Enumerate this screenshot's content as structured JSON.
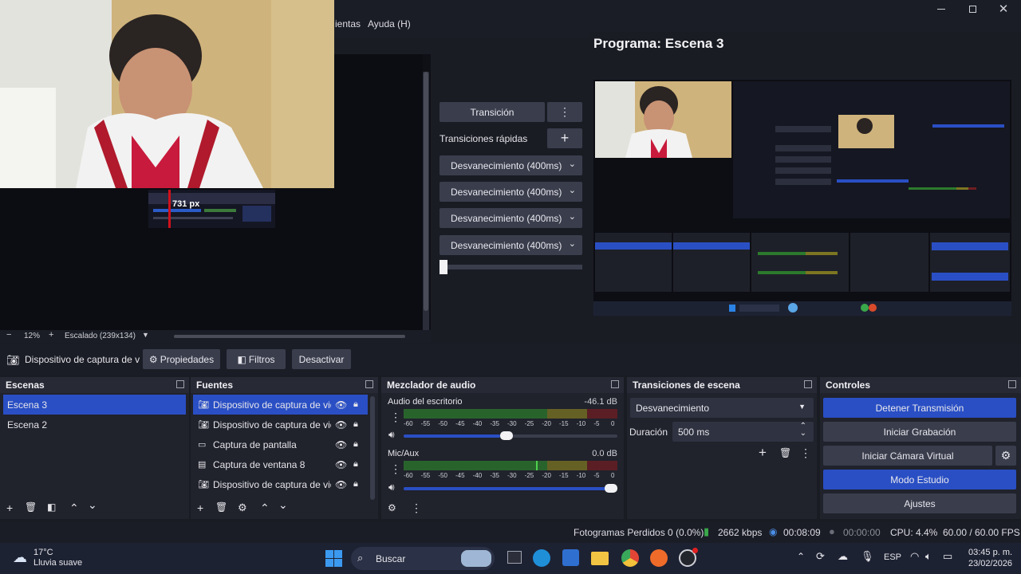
{
  "menu": {
    "item_tools_partial": "ientas",
    "item_help": "Ayuda (H)"
  },
  "program": {
    "title": "Programa: Escena 3"
  },
  "preview": {
    "zoom": "12%",
    "scale_label": "Escalado (239x134)",
    "overlay_px": "731 px"
  },
  "transition_center": {
    "transition_button": "Transición",
    "quick_transitions_label": "Transiciones rápidas",
    "quick_items": [
      "Desvanecimiento (400ms)",
      "Desvanecimiento (400ms)",
      "Desvanecimiento (400ms)",
      "Desvanecimiento (400ms)"
    ]
  },
  "source_toolbar": {
    "source_name": "Dispositivo de captura de v",
    "properties": "Propiedades",
    "filters": "Filtros",
    "deactivate": "Desactivar"
  },
  "scenes": {
    "title": "Escenas",
    "items": [
      {
        "label": "Escena 3",
        "selected": true
      },
      {
        "label": "Escena 2",
        "selected": false
      }
    ]
  },
  "sources": {
    "title": "Fuentes",
    "items": [
      {
        "label": "Dispositivo de captura de vide",
        "icon": "camera-icon",
        "selected": true
      },
      {
        "label": "Dispositivo de captura de vide",
        "icon": "camera-icon",
        "selected": false
      },
      {
        "label": "Captura de pantalla",
        "icon": "monitor-icon",
        "selected": false
      },
      {
        "label": "Captura de ventana 8",
        "icon": "window-icon",
        "selected": false
      },
      {
        "label": "Dispositivo de captura de vide",
        "icon": "camera-icon",
        "selected": false
      }
    ]
  },
  "mixer": {
    "title": "Mezclador de audio",
    "channels": [
      {
        "name": "Audio del escritorio",
        "db": "-46.1 dB",
        "level": 0.0,
        "volume": 0.45
      },
      {
        "name": "Mic/Aux",
        "db": "0.0 dB",
        "level": 0.62,
        "volume": 1.0
      }
    ],
    "ticks": [
      "-60",
      "-55",
      "-50",
      "-45",
      "-40",
      "-35",
      "-30",
      "-25",
      "-20",
      "-15",
      "-10",
      "-5",
      "0"
    ]
  },
  "scene_transitions": {
    "title": "Transiciones de escena",
    "selected": "Desvanecimiento",
    "duration_label": "Duración",
    "duration_value": "500 ms"
  },
  "controls": {
    "title": "Controles",
    "stop_stream": "Detener Transmisión",
    "start_record": "Iniciar Grabación",
    "start_virtual_cam": "Iniciar Cámara Virtual",
    "studio_mode": "Modo Estudio",
    "settings": "Ajustes"
  },
  "status": {
    "dropped_frames": "Fotogramas Perdidos 0 (0.0%)",
    "bitrate": "2662 kbps",
    "stream_time": "00:08:09",
    "record_time": "00:00:00",
    "cpu": "CPU: 4.4%",
    "fps": "60.00 / 60.00 FPS"
  },
  "taskbar": {
    "weather_temp": "17°C",
    "weather_desc": "Lluvia suave",
    "search": "Buscar",
    "lang": "ESP",
    "time": "03:45 p. m.",
    "date": "23/02/2026"
  },
  "colors": {
    "accent": "#2a4fc4",
    "panel": "#20222c",
    "background": "#1a1c24"
  }
}
